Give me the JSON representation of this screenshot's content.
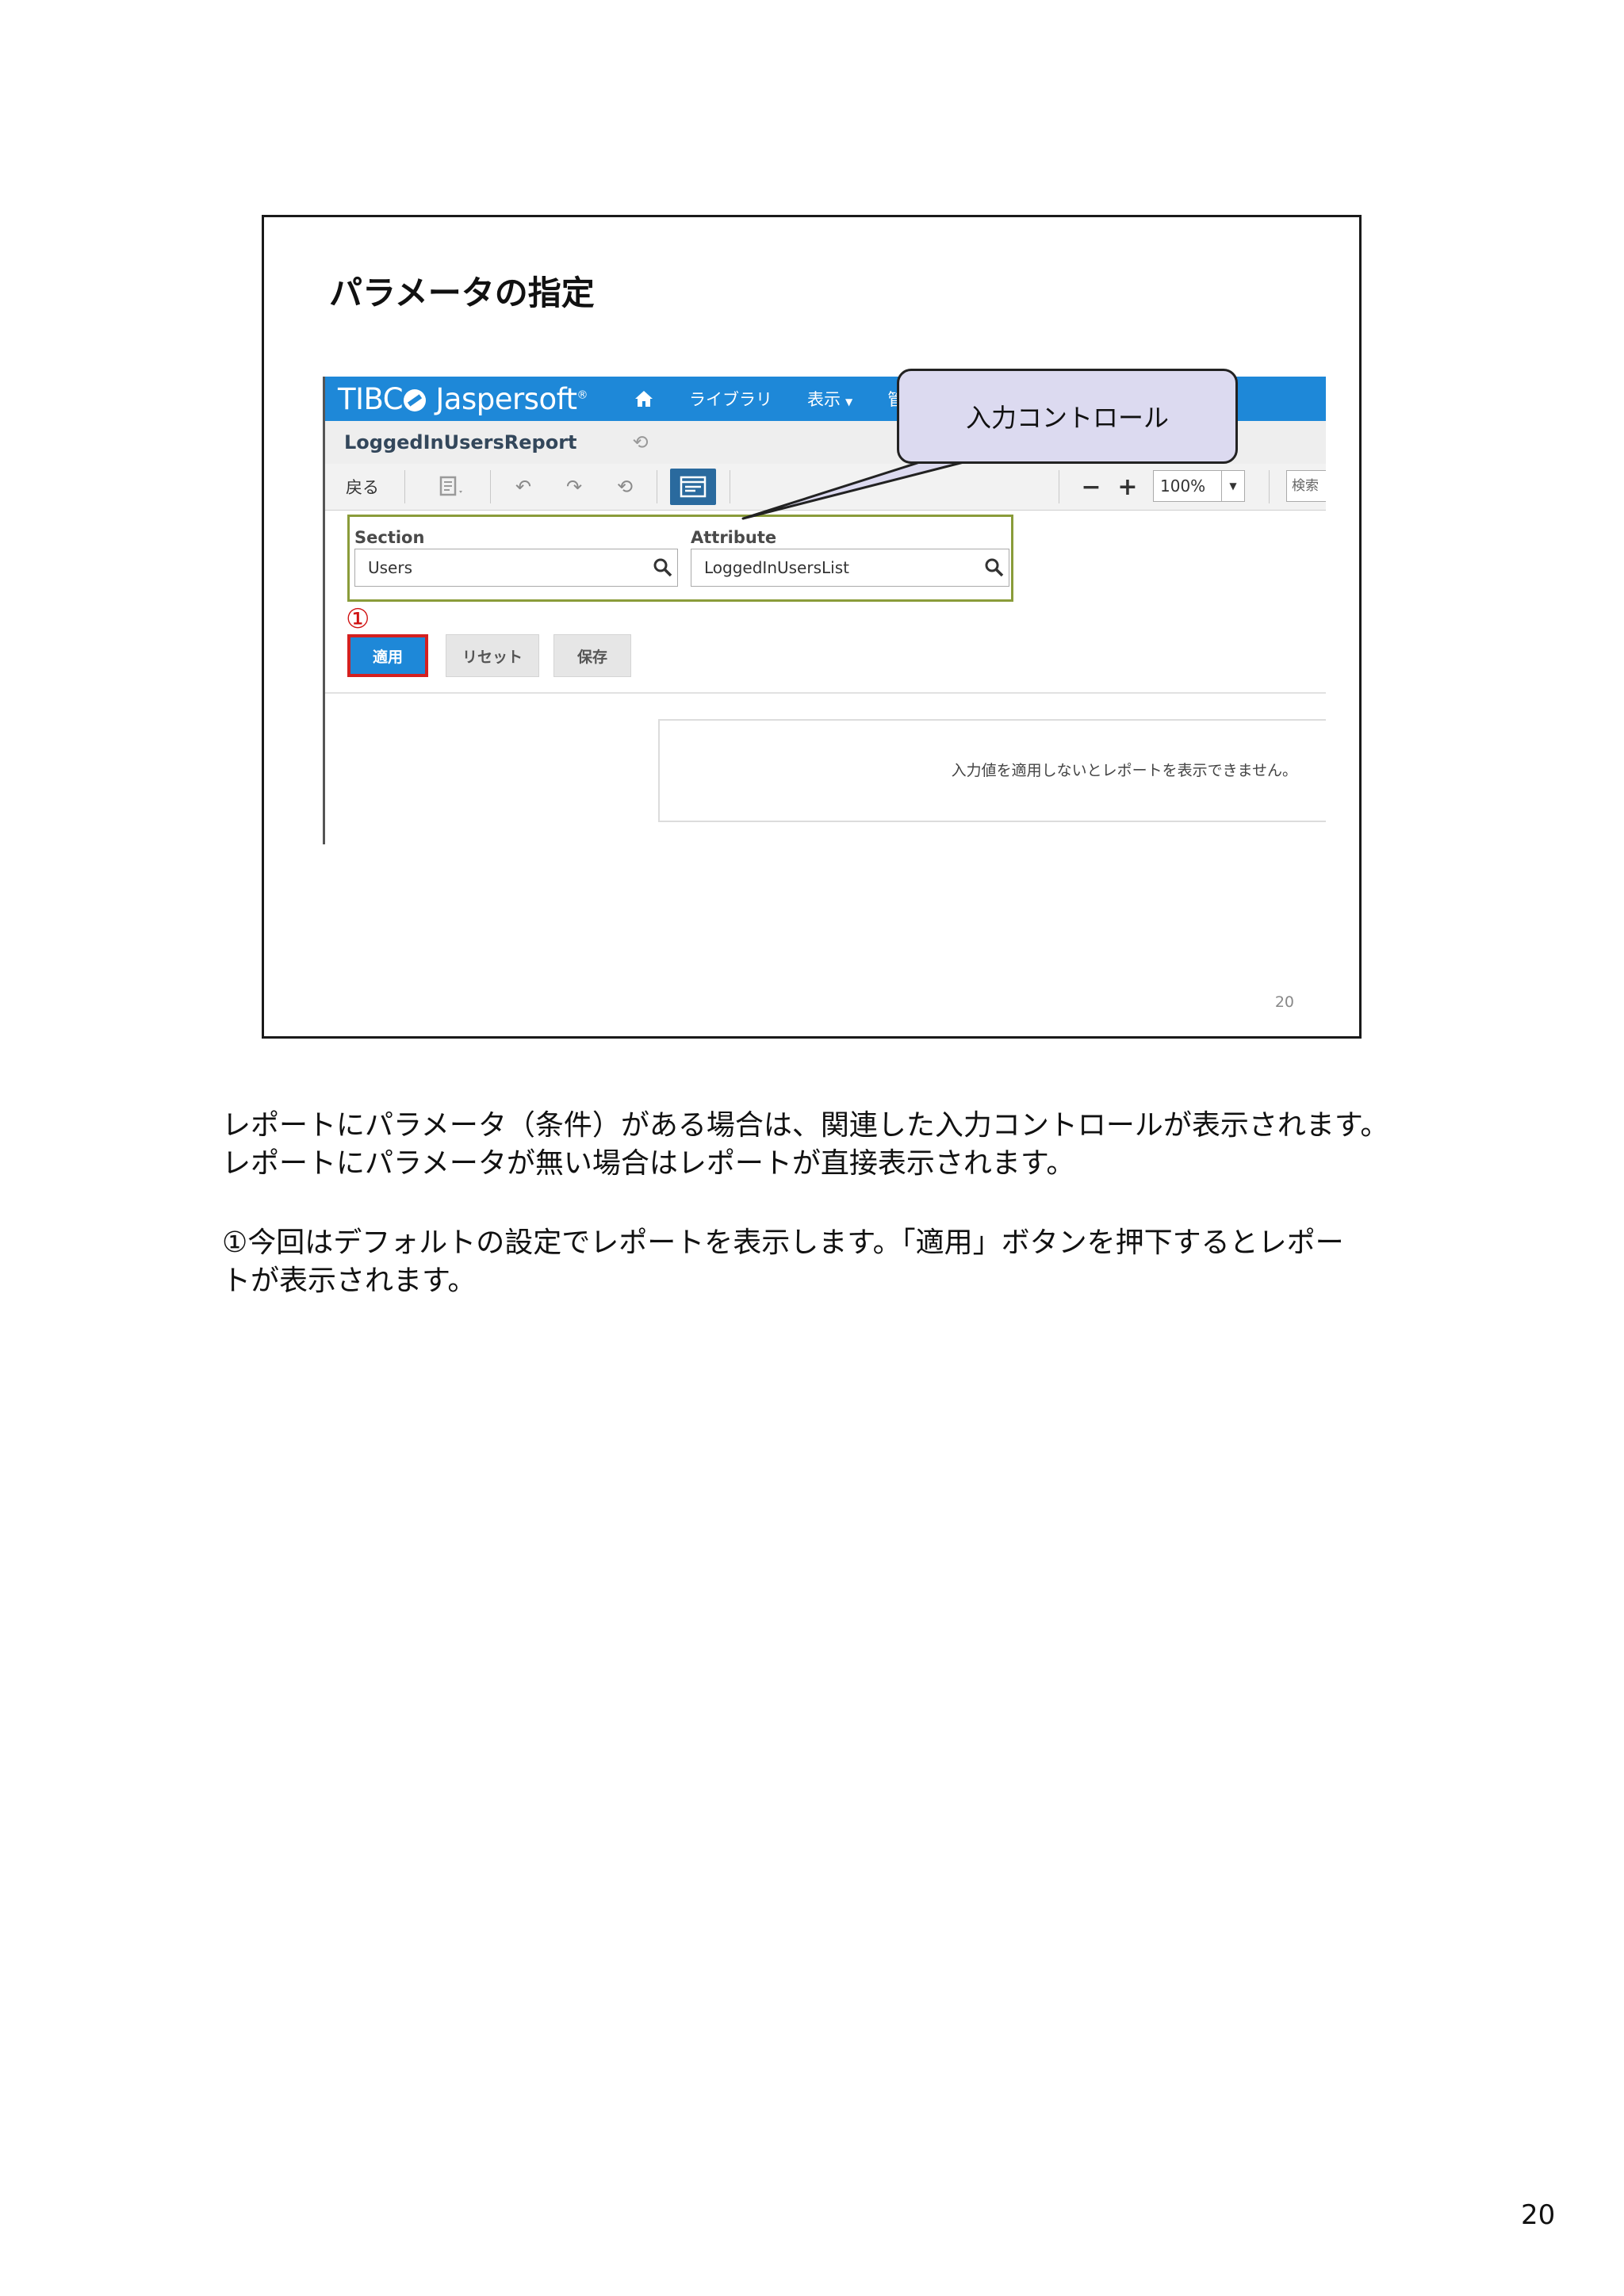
{
  "slide": {
    "title": "パラメータの指定",
    "slide_number": "20"
  },
  "app": {
    "brand": "TIBC",
    "brand_rest": " Jaspersoft",
    "brand_mark": "®",
    "nav": [
      {
        "label": "ライブラリ"
      },
      {
        "label": "表示"
      },
      {
        "label": "管理"
      }
    ],
    "report_name": "LoggedInUsersReport",
    "toolbar": {
      "back_label": "戻る",
      "zoom_value": "100%",
      "search_label": "検索"
    },
    "input_controls": {
      "section_label": "Section",
      "section_value": "Users",
      "attribute_label": "Attribute",
      "attribute_value": "LoggedInUsersList"
    },
    "step_marker": "①",
    "buttons": {
      "apply": "適用",
      "reset": "リセット",
      "save": "保存"
    },
    "message": "入力値を適用しないとレポートを表示できません。"
  },
  "callout": {
    "text": "入力コントロール"
  },
  "body": {
    "para1_line1": "レポートにパラメータ（条件）がある場合は、関連した入力コントロールが表示されます。",
    "para1_line2": "レポートにパラメータが無い場合はレポートが直接表示されます。",
    "para2_line1": "①今回はデフォルトの設定でレポートを表示します。「適用」ボタンを押下するとレポー",
    "para2_line2": "トが表示されます。"
  },
  "page_number": "20",
  "colors": {
    "brand_blue": "#1e88d8",
    "highlight_red": "#d42020",
    "ic_border_green": "#8a9c3a",
    "callout_fill": "#dcdaf0"
  }
}
